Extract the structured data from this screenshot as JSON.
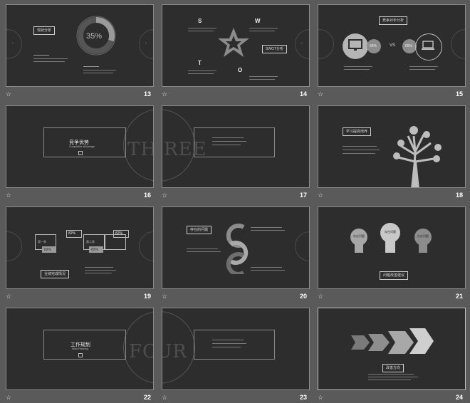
{
  "slides": [
    {
      "number": "13",
      "label": "现状分析",
      "percent": "35%"
    },
    {
      "number": "14",
      "label": "SWOT分析",
      "letters": [
        "S",
        "W",
        "T",
        "O"
      ]
    },
    {
      "number": "15",
      "label": "竞争对手分析",
      "left_pct": "65%",
      "vs": "VS",
      "right_pct": "65%"
    },
    {
      "number": "16",
      "title": "竞争优势",
      "subtitle": "Competitive advantage",
      "big_text": "THREE"
    },
    {
      "number": "17"
    },
    {
      "number": "18",
      "label": "学习提高培养"
    },
    {
      "number": "19",
      "label": "业绩完成情况",
      "pcts": [
        "82%",
        "82%",
        "82%",
        "82%"
      ],
      "items": [
        "第一季",
        "第二季"
      ]
    },
    {
      "number": "20",
      "label": "存在的问题"
    },
    {
      "number": "21",
      "label": "问题改善建议",
      "bulbs": [
        "存在问题",
        "存在问题",
        "存在问题"
      ]
    },
    {
      "number": "22",
      "title": "工作规划",
      "subtitle": "Work Planning",
      "big_text": "FOUR"
    },
    {
      "number": "23"
    },
    {
      "number": "24",
      "label": "改善方向"
    }
  ],
  "star_icon": "☆",
  "colors": {
    "background": "#5a5a5a",
    "slide": "#2d2d2d",
    "border": "#8a8a8a",
    "accent_gray": "#8c8c8c"
  }
}
